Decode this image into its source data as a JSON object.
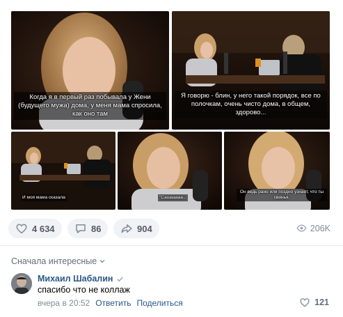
{
  "photos": [
    {
      "caption": "Когда я в первый раз побывала у Жени (будущего мужа) дома, у меня мама спросила, как оно там"
    },
    {
      "caption": "Я говорю - блин, у него такой порядок, все по полочкам, очень чисто дома, в общем, здорово..."
    },
    {
      "caption": "И моя мама сказала:"
    },
    {
      "caption": "\"Сашааааа..."
    },
    {
      "caption": "Он ведь рано или поздно узнает, что ты свинья."
    }
  ],
  "actions": {
    "likes": "4 634",
    "comments": "86",
    "shares": "904",
    "views": "206K"
  },
  "comments_section": {
    "sort_label": "Сначала интересные",
    "comment": {
      "author": "Михаил Шабалин",
      "text": "спасибо что не коллаж",
      "time": "вчера в 20:52",
      "reply": "Ответить",
      "share": "Поделиться",
      "likes": "121"
    }
  },
  "colors": {
    "link": "#2a5885",
    "muted": "#818c99",
    "pill_bg": "#f0f2f5"
  }
}
